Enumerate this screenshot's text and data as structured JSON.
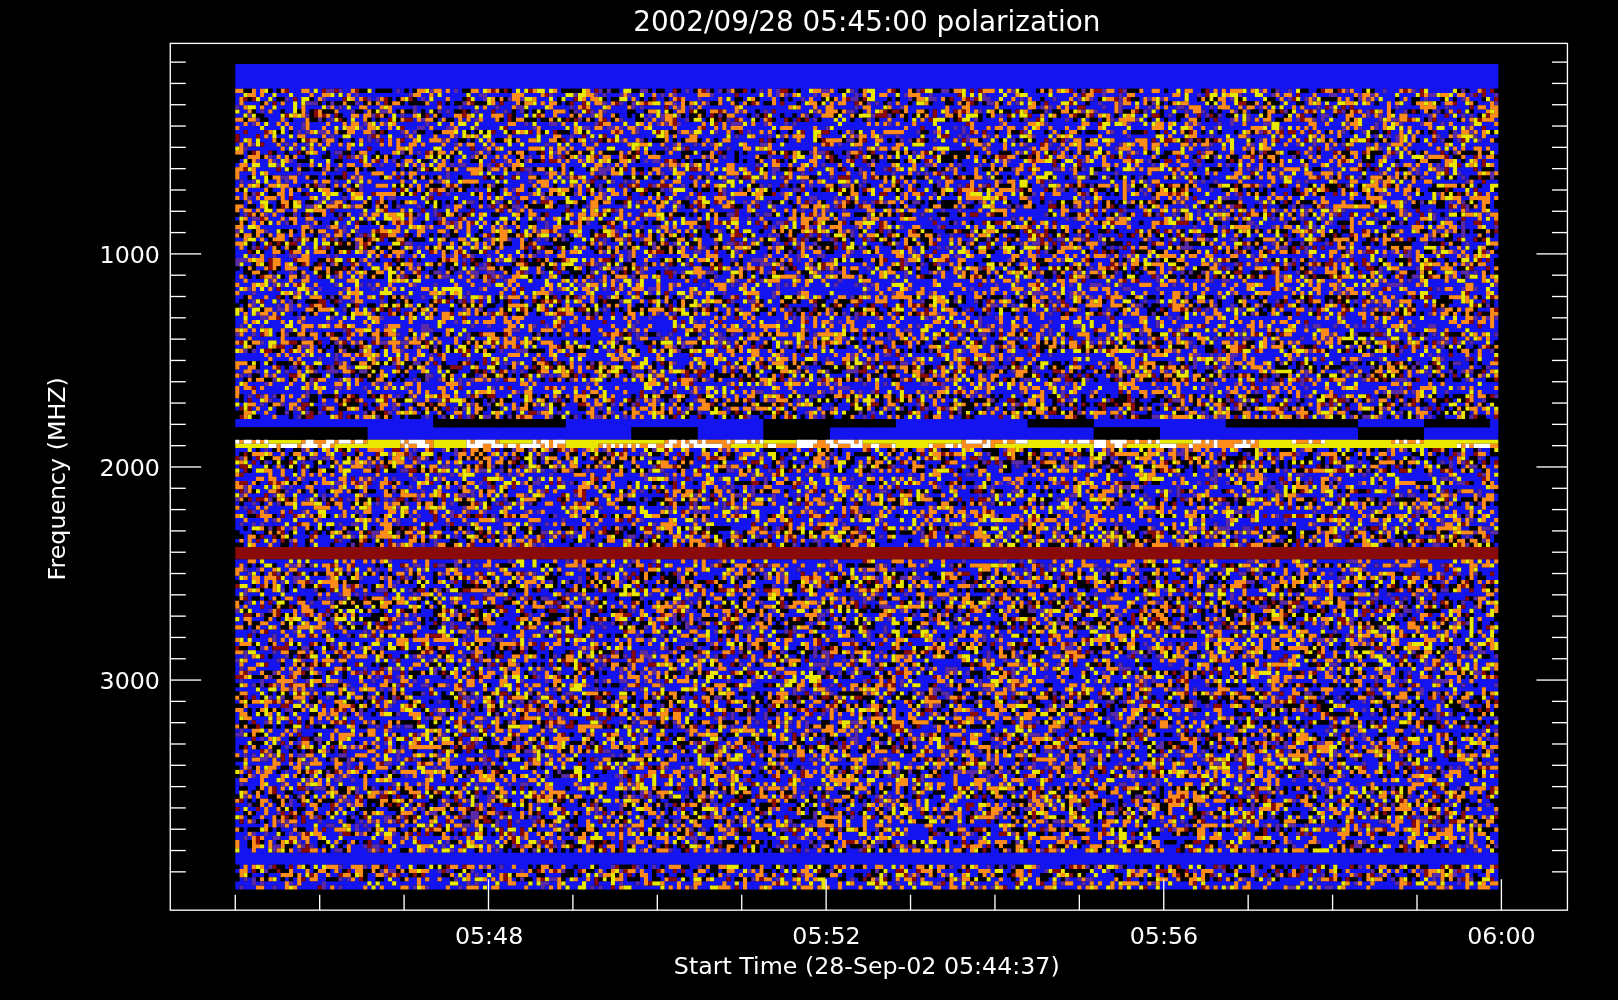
{
  "title": "2002/09/28 05:45:00 polarization",
  "y_axis": {
    "label": "Frequency (MHZ)",
    "tick_labels": [
      "1000",
      "2000",
      "3000"
    ]
  },
  "x_axis": {
    "label": "Start Time (28-Sep-02 05:44:37)",
    "tick_labels": [
      "05:48",
      "05:52",
      "05:56",
      "06:00"
    ]
  }
}
